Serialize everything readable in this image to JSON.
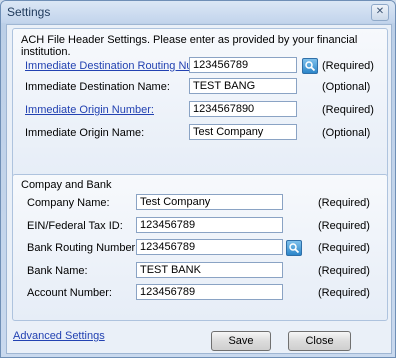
{
  "window": {
    "title": "Settings",
    "close_glyph": "✕"
  },
  "ach": {
    "heading": "ACH File Header Settings.  Please enter as provided by your financial institution.",
    "rows": [
      {
        "label": "Immediate Destination Routing Number:",
        "value": "123456789",
        "note": "(Required)"
      },
      {
        "label": "Immediate Destination Name:",
        "value": "TEST BANG",
        "note": "(Optional)"
      },
      {
        "label": "Immediate Origin Number:",
        "value": "1234567890",
        "note": "(Required)"
      },
      {
        "label": "Immediate Origin Name:",
        "value": "Test Company",
        "note": "(Optional)"
      }
    ]
  },
  "company": {
    "heading": "Compay and Bank",
    "rows": [
      {
        "label": "Company Name:",
        "value": "Test Company",
        "note": "(Required)"
      },
      {
        "label": "EIN/Federal Tax ID:",
        "value": "123456789",
        "note": "(Required)"
      },
      {
        "label": "Bank Routing Number:",
        "value": "123456789",
        "note": "(Required)"
      },
      {
        "label": "Bank Name:",
        "value": "TEST BANK",
        "note": "(Required)"
      },
      {
        "label": "Account Number:",
        "value": "123456789",
        "note": "(Required)"
      }
    ]
  },
  "footer": {
    "advanced_label": "Advanced Settings",
    "save_label": "Save",
    "close_label": "Close"
  },
  "icons": {
    "lookup": "search-icon",
    "close": "close-icon"
  }
}
